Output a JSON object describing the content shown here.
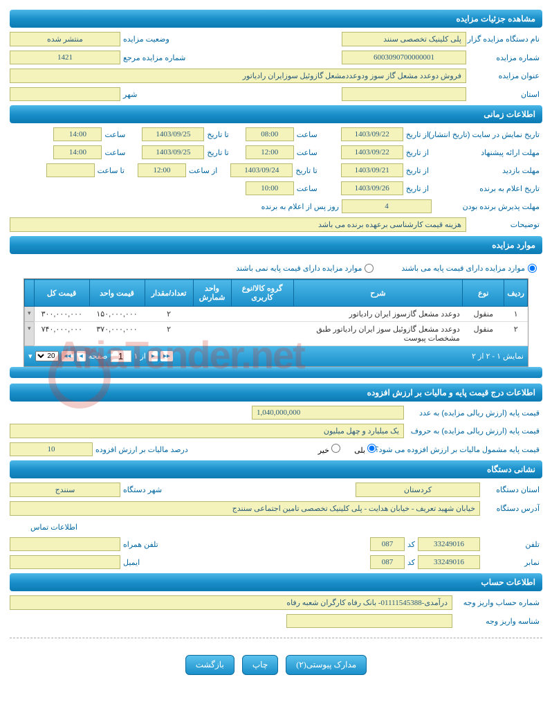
{
  "sections": {
    "details": "مشاهده جزئیات مزایده",
    "time": "اطلاعات زمانی",
    "items": "موارد مزایده",
    "price": "اطلاعات درج قیمت پایه و مالیات بر ارزش افزوده",
    "address": "نشانی دستگاه",
    "account": "اطلاعات حساب"
  },
  "details": {
    "org_label": "نام دستگاه مزایده گزار",
    "org": "پلی کلینیک تخصصی سنند",
    "status_label": "وضعیت مزایده",
    "status": "منتشر شده",
    "num_label": "شماره مزایده",
    "num": "6003090700000001",
    "ref_label": "شماره مزایده مرجع",
    "ref": "1421",
    "title_label": "عنوان مزایده",
    "title": "فروش دوعدد مشعل گاز سوز ودوعددمشعل گازوئیل سوزایران رادیاتور",
    "province_label": "استان",
    "province": "",
    "city_label": "شهر",
    "city": ""
  },
  "time": {
    "publish_label": "تاریخ نمایش در سایت (تاریخ انتشار)",
    "from_label": "از تاریخ",
    "to_label": "تا تاریخ",
    "hour_label": "ساعت",
    "from_hour_label": "از ساعت",
    "to_hour_label": "تا ساعت",
    "publish_from_d": "1403/09/22",
    "publish_from_h": "08:00",
    "publish_to_d": "1403/09/25",
    "publish_to_h": "14:00",
    "offer_label": "مهلت ارائه پیشنهاد",
    "offer_from_d": "1403/09/22",
    "offer_from_h": "12:00",
    "offer_to_d": "1403/09/25",
    "offer_to_h": "14:00",
    "visit_label": "مهلت بازدید",
    "visit_from_d": "1403/09/21",
    "visit_to_d": "1403/09/24",
    "visit_from_h": "12:00",
    "visit_to_h": "",
    "winner_label": "تاریخ اعلام به برنده",
    "winner_from_d": "1403/09/26",
    "winner_h": "10:00",
    "accept_label": "مهلت پذیرش برنده بودن",
    "accept_days": "4",
    "accept_suffix": "روز پس از اعلام به برنده",
    "notes_label": "توضیحات",
    "notes": "هزینه قیمت کارشناسی برعهده برنده می باشد"
  },
  "items": {
    "radio_with": "موارد مزایده دارای قیمت پایه می باشند",
    "radio_without": "موارد مزایده دارای قیمت پایه نمی باشند",
    "headers": {
      "row": "ردیف",
      "type": "نوع",
      "desc": "شرح",
      "group": "گروه کالا/نوع کاربری",
      "unit": "واحد شمارش",
      "qty": "تعداد/مقدار",
      "unit_price": "قیمت واحد",
      "total": "قیمت کل"
    },
    "rows": [
      {
        "n": "۱",
        "type": "منقول",
        "desc": "دوعدد مشعل گازسوز ایران رادیاتور",
        "group": "",
        "unit": "",
        "qty": "۲",
        "unit_price": "۱۵۰,۰۰۰,۰۰۰",
        "total": "۳۰۰,۰۰۰,۰۰۰"
      },
      {
        "n": "۲",
        "type": "منقول",
        "desc": "دوعدد مشعل گازوئیل سوز ایران رادیاتور طبق مشخصات پیوست",
        "group": "",
        "unit": "",
        "qty": "۲",
        "unit_price": "۳۷۰,۰۰۰,۰۰۰",
        "total": "۷۴۰,۰۰۰,۰۰۰"
      }
    ],
    "pager_text": "نمایش ۱ - ۲ از ۲",
    "page_label": "صفحه",
    "page_of": "از ۱",
    "page_val": "1",
    "page_size": "20"
  },
  "price": {
    "base_num_label": "قیمت پایه (ارزش ریالی مزایده) به عدد",
    "base_num": "1,040,000,000",
    "base_txt_label": "قیمت پایه (ارزش ریالی مزایده) به حروف",
    "base_txt": "یک میلیارد و چهل میلیون",
    "vat_q": "قیمت پایه مشمول مالیات بر ارزش افزوده می شود؟",
    "yes": "بلی",
    "no": "خیر",
    "vat_pct_label": "درصد مالیات بر ارزش افزوده",
    "vat_pct": "10"
  },
  "address": {
    "province_label": "استان دستگاه",
    "province": "کردستان",
    "city_label": "شهر دستگاه",
    "city": "سنندج",
    "addr_label": "آدرس دستگاه",
    "addr": "خیابان شهید تعریف - خیابان هدایت - پلی کلینیک تخصصی تامین اجتماعی سنندج",
    "contact_h": "اطلاعات تماس",
    "phone_label": "تلفن",
    "phone": "33249016",
    "code_label": "کد",
    "code": "087",
    "mobile_label": "تلفن همراه",
    "mobile": "",
    "fax_label": "نمابر",
    "fax": "33249016",
    "fax_code": "087",
    "email_label": "ایمیل",
    "email": ""
  },
  "account": {
    "acct_label": "شماره حساب واریز وجه",
    "acct": "درآمدی-01111545388- بانک رفاه کارگران شعبه رفاه",
    "id_label": "شناسه واریز وجه",
    "id": ""
  },
  "buttons": {
    "attach": "مدارک پیوستی(۲)",
    "print": "چاپ",
    "back": "بازگشت"
  },
  "watermark": "AriaTender.net"
}
